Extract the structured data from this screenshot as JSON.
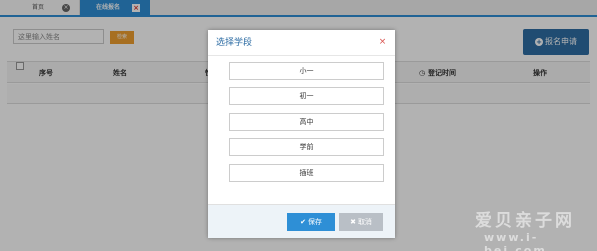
{
  "tabs": [
    {
      "label": "首页",
      "close_icon": "×"
    },
    {
      "label": "在线报名",
      "close_icon": "×"
    }
  ],
  "toolbar": {
    "search_placeholder": "这里输入姓名",
    "search_button": "检索",
    "add_button": "报名申请",
    "add_icon": "+"
  },
  "table": {
    "headers": [
      "序号",
      "姓名",
      "性",
      "登记时间",
      "操作"
    ],
    "clock_icon": "◷"
  },
  "modal": {
    "title": "选择学段",
    "close_icon": "×",
    "options": [
      "小一",
      "初一",
      "高中",
      "学前",
      "插班"
    ],
    "save_label": "保存",
    "save_icon": "✔",
    "cancel_label": "取消",
    "cancel_icon": "✖"
  },
  "watermark": {
    "brand": "爱贝亲子网",
    "url": "www.i-bei.com"
  },
  "colors": {
    "accent": "#2e8fd6",
    "search_button": "#f0a030",
    "add_button": "#2e6da4",
    "close": "#d9534f"
  }
}
